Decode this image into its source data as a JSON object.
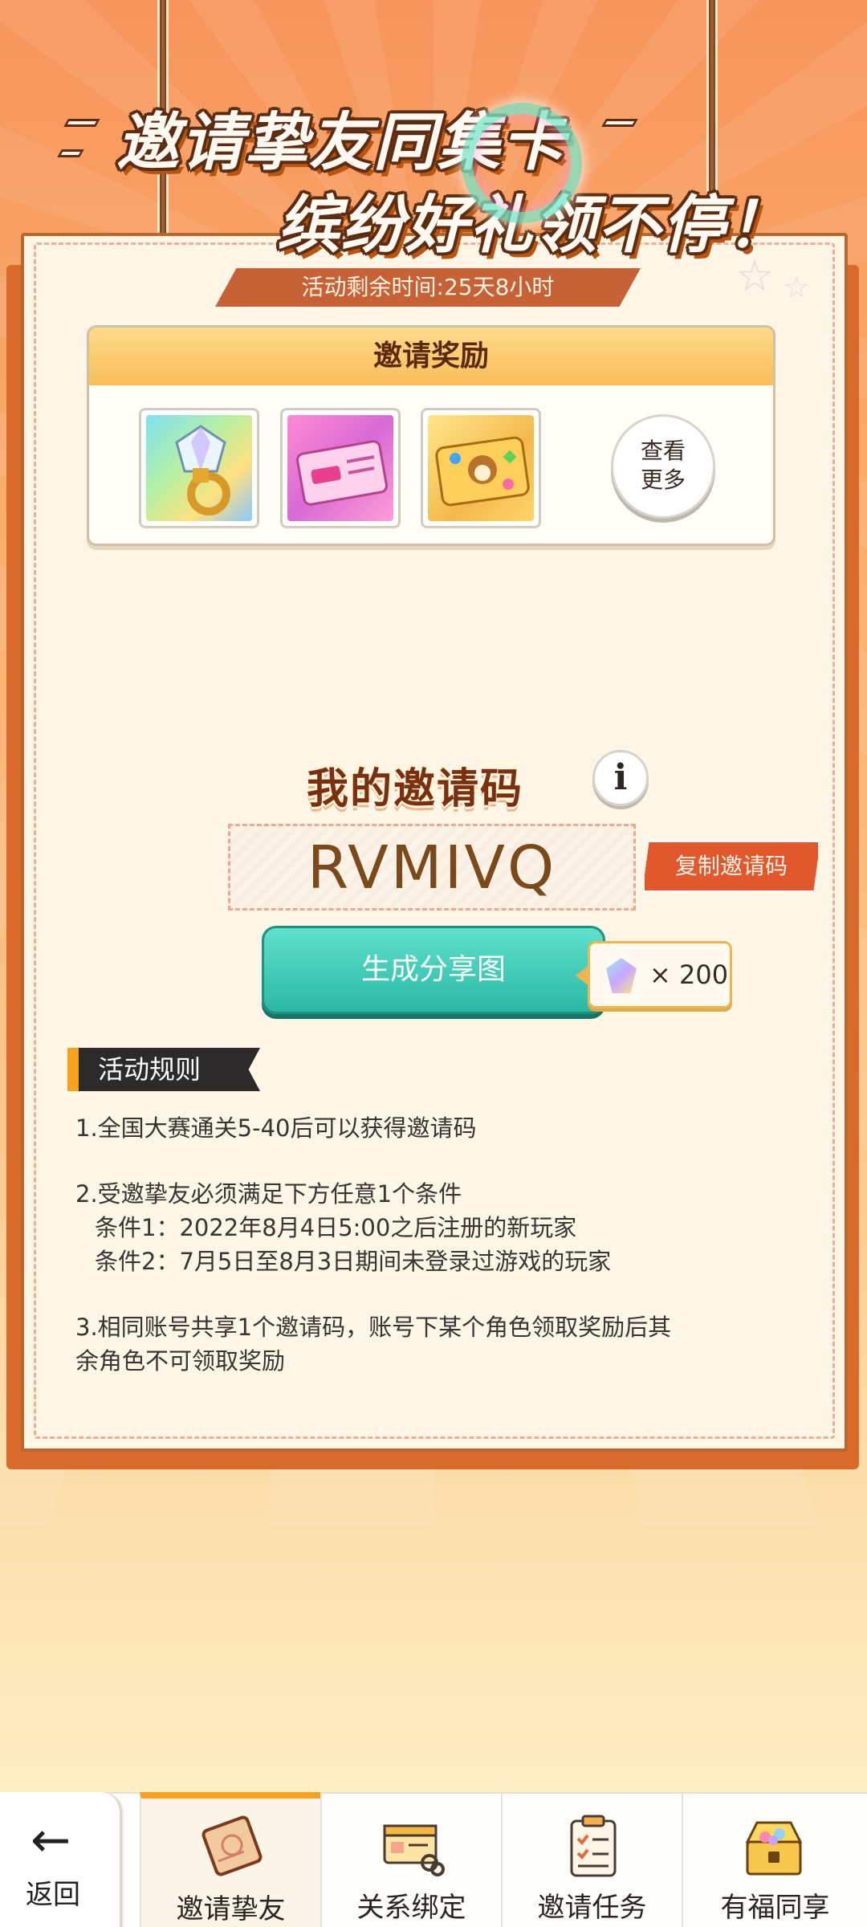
{
  "header": {
    "title_line1": "邀请挚友同集卡",
    "title_line2": "缤纷好礼领不停！",
    "timer": "活动剩余时间:25天8小时"
  },
  "rewards": {
    "title": "邀请奖励",
    "items": [
      {
        "icon": "gem-ring-icon"
      },
      {
        "icon": "pink-ticket-icon"
      },
      {
        "icon": "card-pack-icon"
      }
    ],
    "more_label": "查看\n更多"
  },
  "invite": {
    "title": "我的邀请码",
    "info_label": "i",
    "code": "RVMIVQ",
    "copy_label": "复制邀请码",
    "generate_label": "生成分享图",
    "cost_text": "× 200"
  },
  "rules": {
    "tab_label": "活动规则",
    "lines": [
      "1.全国大赛通关5-40后可以获得邀请码",
      "2.受邀挚友必须满足下方任意1个条件",
      "条件1：2022年8月4日5:00之后注册的新玩家",
      "条件2：7月5日至8月3日期间未登录过游戏的玩家",
      "3.相同账号共享1个邀请码，账号下某个角色领取奖励后其",
      "余角色不可领取奖励"
    ]
  },
  "nav": {
    "back_label": "返回",
    "tabs": [
      {
        "label": "邀请挚友",
        "icon": "invite-scroll-icon",
        "active": true
      },
      {
        "label": "关系绑定",
        "icon": "id-card-link-icon",
        "active": false
      },
      {
        "label": "邀请任务",
        "icon": "clipboard-checklist-icon",
        "active": false
      },
      {
        "label": "有福同享",
        "icon": "treasure-chest-icon",
        "active": false
      }
    ]
  },
  "colors": {
    "accent_orange": "#f7a21f",
    "panel_border": "#b8682d",
    "generate_teal": "#2bb9a4",
    "copy_red": "#e0582c"
  }
}
